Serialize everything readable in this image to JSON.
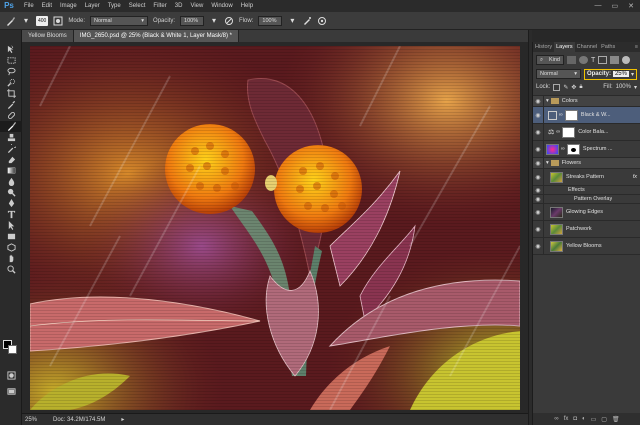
{
  "app": {
    "logo": "Ps"
  },
  "menu": [
    "File",
    "Edit",
    "Image",
    "Layer",
    "Type",
    "Select",
    "Filter",
    "3D",
    "View",
    "Window",
    "Help"
  ],
  "window_controls": [
    "—",
    "▭",
    "✕"
  ],
  "options": {
    "brush_size": "400",
    "mode_label": "Mode:",
    "mode_value": "Normal",
    "opacity_label": "Opacity:",
    "opacity_value": "100%",
    "flow_label": "Flow:",
    "flow_value": "100%"
  },
  "doc_tabs": [
    {
      "label": "Yellow Blooms"
    },
    {
      "label": "IMG_2650.psd @ 25% (Black & White 1, Layer Mask/8) *"
    }
  ],
  "status": {
    "zoom": "25%",
    "doc": "Doc: 34.2M/174.5M"
  },
  "panel_tabs": [
    "History",
    "Layers",
    "Channel",
    "Paths"
  ],
  "layers_panel": {
    "kind": "Kind",
    "blend": "Normal",
    "opacity_label": "Opacity:",
    "opacity_value": "25%",
    "lock_label": "Lock:",
    "fill_label": "Fill:",
    "fill_value": "100%"
  },
  "layers": [
    {
      "name": "Colors",
      "type": "group"
    },
    {
      "name": "Black & W...",
      "type": "adjust",
      "selected": true
    },
    {
      "name": "Color Bala...",
      "type": "adjust"
    },
    {
      "name": "Spectrum ...",
      "type": "gradient"
    },
    {
      "name": "Flowers",
      "type": "group"
    },
    {
      "name": "Streaks Pattern",
      "type": "image",
      "fx": "fx"
    },
    {
      "name": "Effects",
      "type": "effect"
    },
    {
      "name": "Pattern Overlay",
      "type": "effect2"
    },
    {
      "name": "Glowing Edges",
      "type": "image"
    },
    {
      "name": "Patchwork",
      "type": "image"
    },
    {
      "name": "Yellow Blooms",
      "type": "image"
    }
  ],
  "colors": {
    "accent": "#4d5e7b",
    "highlight": "#f2c200"
  }
}
